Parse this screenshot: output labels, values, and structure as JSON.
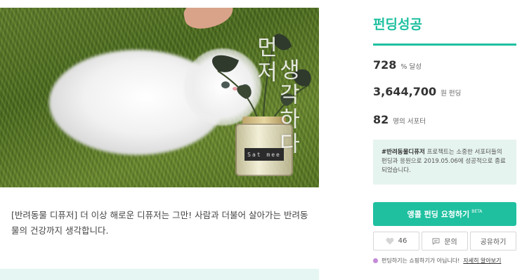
{
  "hero": {
    "overlay_text_1": "먼저",
    "overlay_text_2": "생각하다",
    "jar_label": "Sat mee"
  },
  "summary": {
    "text": "[반려동물 디퓨저] 더 이상 해로운 디퓨저는 그만! 사람과 더불어 살아가는 반려동물의 건강까지 생각합니다."
  },
  "status": {
    "title": "펀딩성공"
  },
  "stats": [
    {
      "num": "728",
      "unit": "% 달성"
    },
    {
      "num": "3,644,700",
      "unit": "원 펀딩"
    },
    {
      "num": "82",
      "unit": "명의 서포터"
    }
  ],
  "info": {
    "project_name": "#반려동물디퓨저",
    "text": " 프로젝트는 소중한 서포터들의 펀딩과 응원으로 2019.05.06에 성공적으로 종료되었습니다."
  },
  "request_button": {
    "label": "앵콜 펀딩 요청하기",
    "badge": "BETA"
  },
  "actions": {
    "like_count": "46",
    "ask_label": "문의",
    "share_label": "공유하기"
  },
  "notice": {
    "text": "펀딩하기는 쇼핑하기가 아닙니다!",
    "link": "자세히 알아보기"
  },
  "colors": {
    "accent": "#1fc0a0",
    "info_bg": "#e6f4f0",
    "notice_dot": "#c48ad8"
  }
}
